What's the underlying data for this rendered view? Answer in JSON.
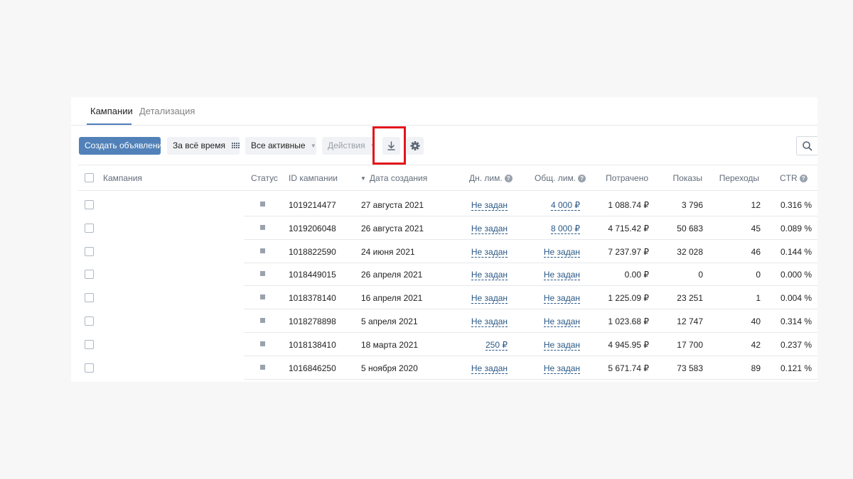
{
  "tabs": {
    "campaigns": "Кампании",
    "details": "Детализация"
  },
  "toolbar": {
    "create_ad": "Создать объявление",
    "period": "За всё время",
    "status_filter": "Все активные",
    "actions": "Действия"
  },
  "table": {
    "headers": {
      "campaign": "Кампания",
      "status": "Статус",
      "id": "ID кампании",
      "created": "Дата создания",
      "daily_limit": "Дн. лим.",
      "total_limit": "Общ. лим.",
      "spent": "Потрачено",
      "impressions": "Показы",
      "clicks": "Переходы",
      "ctr": "CTR"
    },
    "rows": [
      {
        "id": "1019214477",
        "created": "27 августа 2021",
        "daily_limit": "Не задан",
        "total_limit": "4 000 ₽",
        "spent": "1 088.74 ₽",
        "impressions": "3 796",
        "clicks": "12",
        "ctr": "0.316 %"
      },
      {
        "id": "1019206048",
        "created": "26 августа 2021",
        "daily_limit": "Не задан",
        "total_limit": "8 000 ₽",
        "spent": "4 715.42 ₽",
        "impressions": "50 683",
        "clicks": "45",
        "ctr": "0.089 %"
      },
      {
        "id": "1018822590",
        "created": "24 июня 2021",
        "daily_limit": "Не задан",
        "total_limit": "Не задан",
        "spent": "7 237.97 ₽",
        "impressions": "32 028",
        "clicks": "46",
        "ctr": "0.144 %"
      },
      {
        "id": "1018449015",
        "created": "26 апреля 2021",
        "daily_limit": "Не задан",
        "total_limit": "Не задан",
        "spent": "0.00 ₽",
        "impressions": "0",
        "clicks": "0",
        "ctr": "0.000 %"
      },
      {
        "id": "1018378140",
        "created": "16 апреля 2021",
        "daily_limit": "Не задан",
        "total_limit": "Не задан",
        "spent": "1 225.09 ₽",
        "impressions": "23 251",
        "clicks": "1",
        "ctr": "0.004 %"
      },
      {
        "id": "1018278898",
        "created": "5 апреля 2021",
        "daily_limit": "Не задан",
        "total_limit": "Не задан",
        "spent": "1 023.68 ₽",
        "impressions": "12 747",
        "clicks": "40",
        "ctr": "0.314 %"
      },
      {
        "id": "1018138410",
        "created": "18 марта 2021",
        "daily_limit": "250 ₽",
        "total_limit": "Не задан",
        "spent": "4 945.95 ₽",
        "impressions": "17 700",
        "clicks": "42",
        "ctr": "0.237 %"
      },
      {
        "id": "1016846250",
        "created": "5 ноября 2020",
        "daily_limit": "Не задан",
        "total_limit": "Не задан",
        "spent": "5 671.74 ₽",
        "impressions": "73 583",
        "clicks": "89",
        "ctr": "0.121 %"
      }
    ]
  },
  "colors": {
    "accent": "#5181b8",
    "link": "#2a5885",
    "highlight": "#e3141a"
  }
}
